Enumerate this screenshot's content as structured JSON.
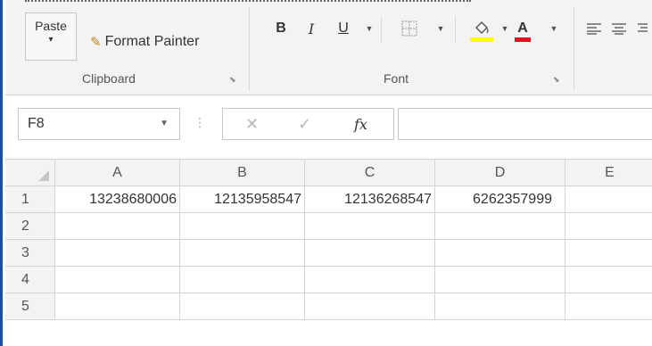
{
  "clipboard": {
    "paste_label": "Paste",
    "paste_arrow": "▾",
    "format_painter_label": "Format Painter",
    "group_label": "Clipboard"
  },
  "font": {
    "bold": "B",
    "italic": "I",
    "underline": "U",
    "font_color_letter": "A",
    "group_label": "Font"
  },
  "icons": {
    "paste": "clipboard-icon",
    "format_painter": "paintbrush-icon",
    "borders": "borders-icon",
    "fill_color": "fill-bucket-icon",
    "align_left": "align-left-icon",
    "align_center": "align-center-icon",
    "cancel": "cancel-icon",
    "enter": "checkmark-icon",
    "launcher": "dialog-launcher-icon"
  },
  "colors": {
    "fill_color_bar": "#ffff00",
    "font_color_bar": "#e81123",
    "window_border": "#1f4e9e"
  },
  "formula_bar": {
    "name_box_value": "F8",
    "fx_label": "fx",
    "formula_value": ""
  },
  "sheet": {
    "columns": [
      "A",
      "B",
      "C",
      "D",
      "E"
    ],
    "rows": [
      {
        "num": "1",
        "cells": [
          "13238680006",
          "12135958547",
          "12136268547",
          "6262357999",
          ""
        ]
      },
      {
        "num": "2",
        "cells": [
          "",
          "",
          "",
          "",
          ""
        ]
      },
      {
        "num": "3",
        "cells": [
          "",
          "",
          "",
          "",
          ""
        ]
      },
      {
        "num": "4",
        "cells": [
          "",
          "",
          "",
          "",
          ""
        ]
      },
      {
        "num": "5",
        "cells": [
          "",
          "",
          "",
          "",
          ""
        ]
      }
    ]
  }
}
